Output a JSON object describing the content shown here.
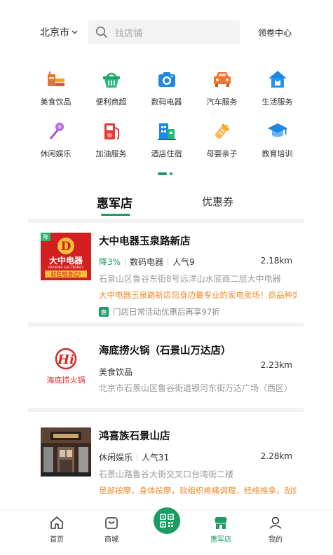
{
  "header": {
    "city": "北京市",
    "search_placeholder": "找店铺",
    "coupon_center": "领卷中心"
  },
  "categories": [
    {
      "label": "美食饮品",
      "icon": "food-drink-icon"
    },
    {
      "label": "便利商超",
      "icon": "basket-icon"
    },
    {
      "label": "数码电器",
      "icon": "camera-icon"
    },
    {
      "label": "汽车服务",
      "icon": "car-icon"
    },
    {
      "label": "生活服务",
      "icon": "house-icon"
    },
    {
      "label": "休闲娱乐",
      "icon": "microphone-icon"
    },
    {
      "label": "加油服务",
      "icon": "fuel-icon"
    },
    {
      "label": "酒店住宿",
      "icon": "hotel-icon"
    },
    {
      "label": "母婴亲子",
      "icon": "baby-bottle-icon"
    },
    {
      "label": "教育培训",
      "icon": "graduation-cap-icon"
    }
  ],
  "tabs": {
    "active": "惠军店",
    "inactive": "优惠券"
  },
  "shops": [
    {
      "name": "大中电器玉泉路新店",
      "badge": "降",
      "discount": "降3%",
      "category": "数码电器",
      "popularity": "人气9",
      "distance": "2.18km",
      "address": "石景山区鲁谷东街8号远洋山水底商二层大中电器",
      "description": "大中电器玉泉路新店您身边最专业的家电卖场！商品种类齐全",
      "promo_tag": "惠",
      "promo": "门店日常活动优惠后再享97折",
      "logo_text": "大中电器",
      "logo_sub": "DAZHONG ELECTRONICS",
      "logo_slogan": "就在咱身边!"
    },
    {
      "name": "海底捞火锅（石景山万达店）",
      "category": "美食饮品",
      "distance": "2.23km",
      "address": "北京市石景山区鲁谷街道银河东街万达广场（西区）",
      "logo_text": "海底捞火锅",
      "logo_mark": "Hi"
    },
    {
      "name": "鸿喜族石景山店",
      "category": "休闲娱乐",
      "popularity": "人气31",
      "distance": "2.28km",
      "address": "石景山路鲁谷大街交叉口台湾街二楼",
      "description": "足部按摩，身体按摩，软组织疼痛调理，经络推拿，刮痧"
    }
  ],
  "bottom_nav": [
    {
      "label": "首页",
      "icon": "home-icon"
    },
    {
      "label": "商城",
      "icon": "mall-bag-icon"
    },
    {
      "label": "",
      "icon": "qr-scan-icon"
    },
    {
      "label": "惠军店",
      "icon": "store-icon"
    },
    {
      "label": "我的",
      "icon": "user-icon"
    }
  ],
  "colors": {
    "brand_green": "#1b9c63",
    "orange_text": "#f08a2a",
    "gray_text": "#999999"
  }
}
